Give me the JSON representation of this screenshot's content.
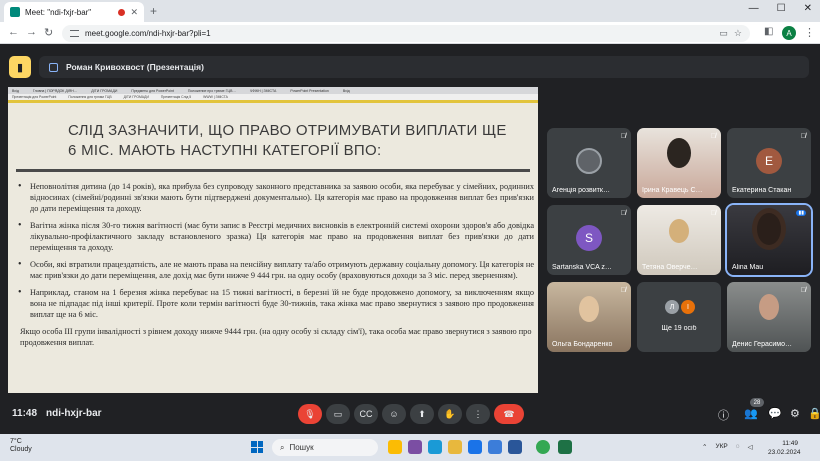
{
  "browser": {
    "tab_title": "Meet: \"ndi-fxjr-bar\"",
    "new_tab": "+",
    "url": "meet.google.com/ndi-hxjr-bar?pli=1",
    "profile_initial": "A",
    "win_minimize": "—",
    "win_maximize": "☐",
    "win_close": "✕"
  },
  "meet": {
    "presenter_label": "Роман Кривохвост (Презентація)",
    "time": "11:48",
    "meeting_code": "ndi-hxjr-bar",
    "participant_count": "28",
    "accent": "#8ab4f8",
    "danger": "#ea4335"
  },
  "slide": {
    "inner_tabs": [
      "Вхід",
      "Гловна | ПОРЯДОК ДІЯН…",
      "ДІТИ ГРОМАДИ",
      "Предметы для PowerPoint",
      "Положение про трюме ГЦВ…",
      "ЧФЖН | ЗМІСТА",
      "PowerPoint Presentation",
      "Вхід"
    ],
    "inner_addr": [
      "Презентація для PowerPoint",
      "Положення для трюми ГЦВ",
      "ДІТИ ГРОМАДИ",
      "Презентація Слід 5",
      "WWW | ЗМІСТА"
    ],
    "title": "СЛІД ЗАЗНАЧИТИ, ЩО ПРАВО ОТРИМУВАТИ ВИПЛАТИ ЩЕ 6 МІС. МАЮТЬ НАСТУПНІ КАТЕГОРІЇ ВПО:",
    "bullets": [
      "Неповнолітня дитина (до 14 років), яка прибула без супроводу законного представника за заявою особи, яка перебуває у сімейних, родинних відносинах (сімейні/родинні зв'язки мають бути підтверджені документально). Ця категорія має право на продовження виплат без прив'язки до дати переміщення та доходу.",
      "Вагітна жінка після 30-го тижня вагітності (має бути запис в Реєстрі медичних висновків в електронній системі охорони здоров'я або довідка лікувально-профілактичного закладу встановленого зразка) Ця категорія має право на продовження виплат без прив'язки до дати переміщення та доходу.",
      "Особи, які втратили працездатність, але не мають права на пенсійну виплату та/або отримують державну соціальну допомогу. Ця категорія не має прив'язки до дати переміщення, але дохід має бути нижче 9 444 грн. на одну особу (враховуються доходи за 3 міс. перед зверненням).",
      "Наприклад, станом на 1 березня жінка перебуває на 15 тижні вагітності, в березні їй не буде продовжено допомогу, за виключенням якщо вона не підпадає під інші критерії. Проте коли термін вагітності буде 30-тижнів, така жінка має право звернутися з заявою про продовження виплат ще на 6 міс."
    ],
    "footer_text": "Якщо особа ІІІ групи інвалідності з рівнем доходу нижче 9444 грн. (на одну особу зі складу сім'ї), така особа має право звернутися з заявою про продовження виплат."
  },
  "participants": [
    {
      "name": "Агенція розвитк…",
      "initial": "",
      "color": "#3c4043",
      "muted": "🎙̸"
    },
    {
      "name": "Ірина Кравець С…",
      "initial": "",
      "color": "#c9a89a",
      "muted": "🎙̸"
    },
    {
      "name": "Екатерина Стакан",
      "initial": "Е",
      "color": "#a1593f",
      "muted": "🎙̸"
    },
    {
      "name": "Sartanska VCA z…",
      "initial": "S",
      "color": "#7e57c2",
      "muted": "🎙̸"
    },
    {
      "name": "Тетяна Оверче…",
      "initial": "",
      "color": "#d7d2c8",
      "muted": "🎙̸"
    },
    {
      "name": "Alina Mau",
      "initial": "",
      "color": "#2f2f35",
      "muted": "▮▮"
    },
    {
      "name": "Ольга Бондаренко",
      "initial": "",
      "color": "#b59a7a",
      "muted": "🎙̸"
    },
    {
      "name": "Ще 19 осіб",
      "initial": "",
      "color": "#3c4043",
      "muted": ""
    },
    {
      "name": "Денис Герасимо…",
      "initial": "",
      "color": "#6d6f6f",
      "muted": "🎙̸"
    }
  ],
  "more_avatars": {
    "a": "Л",
    "b": "І"
  },
  "controls": {
    "mic": "🎙",
    "cam": "▭",
    "cc": "CC",
    "emoji": "☺",
    "present": "⬆",
    "raise": "✋",
    "more": "⋮",
    "hang": "☎"
  },
  "right_controls": {
    "info": "ⓘ",
    "people": "👥",
    "chat": "💬",
    "activities": "⚙",
    "lock": "🔒"
  },
  "taskbar": {
    "temp": "7°C",
    "weather": "Cloudy",
    "search": "Пошук",
    "lang": "УКР",
    "time": "11:49",
    "date": "23.02.2024"
  }
}
